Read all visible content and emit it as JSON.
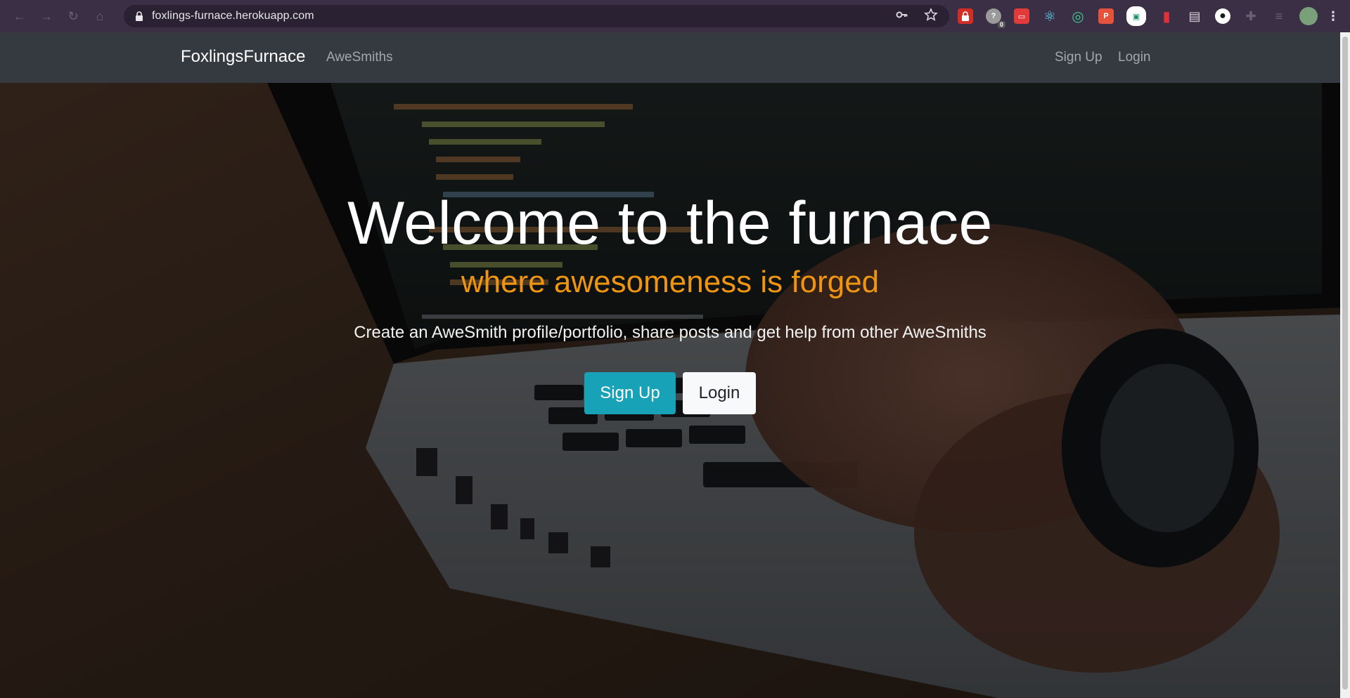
{
  "browser": {
    "url": "foxlings-furnace.herokuapp.com",
    "extension_badge": "0",
    "extensions": [
      {
        "name": "lastpass-icon",
        "color": "#d32d27",
        "text": "🔒"
      },
      {
        "name": "help-extension-icon",
        "color": "#9a9a9a",
        "text": "?"
      },
      {
        "name": "ext-red-icon",
        "color": "#e03a3a",
        "text": "▭"
      },
      {
        "name": "react-devtools-icon",
        "color": "#2a2a3a",
        "text": "⚛"
      },
      {
        "name": "ext-green-ring-icon",
        "color": "#1f8f6b",
        "text": "◎"
      },
      {
        "name": "ext-p-icon",
        "color": "#e5533c",
        "text": "P"
      },
      {
        "name": "ext-screen-icon",
        "color": "#ffffff",
        "text": "▣"
      },
      {
        "name": "bookmark-ext-icon",
        "color": "#e0303a",
        "text": "🔖"
      },
      {
        "name": "ext-window-icon",
        "color": "#6b6b7a",
        "text": "▤"
      },
      {
        "name": "github-icon",
        "color": "#1b1b1b",
        "text": "●"
      },
      {
        "name": "extensions-puzzle-icon",
        "color": "#3a2f45",
        "text": "✚"
      },
      {
        "name": "media-icon",
        "color": "#3a2f45",
        "text": "≡"
      }
    ]
  },
  "navbar": {
    "brand": "FoxlingsFurnace",
    "links": {
      "awesmiths": "AweSmiths",
      "signup": "Sign Up",
      "login": "Login"
    }
  },
  "hero": {
    "title": "Welcome to the furnace",
    "subtitle": "where awesomeness is forged",
    "lead": "Create an AweSmith profile/portfolio, share posts and get help from other AweSmiths",
    "signup_button": "Sign Up",
    "login_button": "Login"
  },
  "colors": {
    "navbar": "#343a40",
    "accent_orange": "#f0950f",
    "signup_button": "#17a2b8",
    "login_button": "#f8f9fa"
  }
}
